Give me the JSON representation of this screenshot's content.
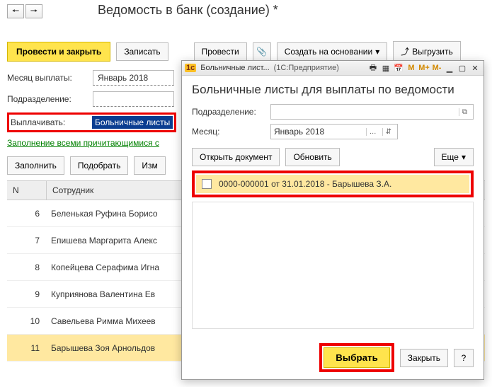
{
  "page": {
    "title": "Ведомость в банк (создание) *"
  },
  "nav": {
    "back": "🠔",
    "forward": "🠖"
  },
  "toolbar": {
    "submit_close": "Провести и закрыть",
    "write": "Записать",
    "submit": "Провести",
    "attach_icon": "📎",
    "create_basis": "Создать на основании",
    "export_icon": "⤴",
    "export": "Выгрузить"
  },
  "form": {
    "month_label": "Месяц выплаты:",
    "month_value": "Январь 2018",
    "division_label": "Подразделение:",
    "division_value": "",
    "pay_label": "Выплачивать:",
    "pay_value": "Больничные листы",
    "fill_link": "Заполнение всеми причитающимися с"
  },
  "toolbar2": {
    "fill": "Заполнить",
    "pick": "Подобрать",
    "edit": "Изм"
  },
  "grid": {
    "header_n": "N",
    "header_emp": "Сотрудник",
    "rows": [
      {
        "n": "6",
        "emp": "Беленькая Руфина Борисо"
      },
      {
        "n": "7",
        "emp": "Епишева Маргарита Алекс"
      },
      {
        "n": "8",
        "emp": "Копейцева Серафима Игна"
      },
      {
        "n": "9",
        "emp": "Куприянова Валентина Ев"
      },
      {
        "n": "10",
        "emp": "Савельева Римма Михеев"
      },
      {
        "n": "11",
        "emp": "Барышева Зоя Арнольдов"
      }
    ]
  },
  "dialog": {
    "titlebar": {
      "app_icon": "1c",
      "title": "Больничные лист...",
      "subtitle": "(1С:Предприятие)"
    },
    "heading": "Больничные листы для выплаты по ведомости",
    "division_label": "Подразделение:",
    "division_value": "",
    "month_label": "Месяц:",
    "month_value": "Январь 2018",
    "toolbar": {
      "open_doc": "Открыть документ",
      "refresh": "Обновить",
      "more": "Еще"
    },
    "items": [
      {
        "text": "0000-000001 от 31.01.2018 - Барышева З.А."
      }
    ],
    "footer": {
      "select": "Выбрать",
      "close": "Закрыть",
      "help": "?"
    }
  }
}
